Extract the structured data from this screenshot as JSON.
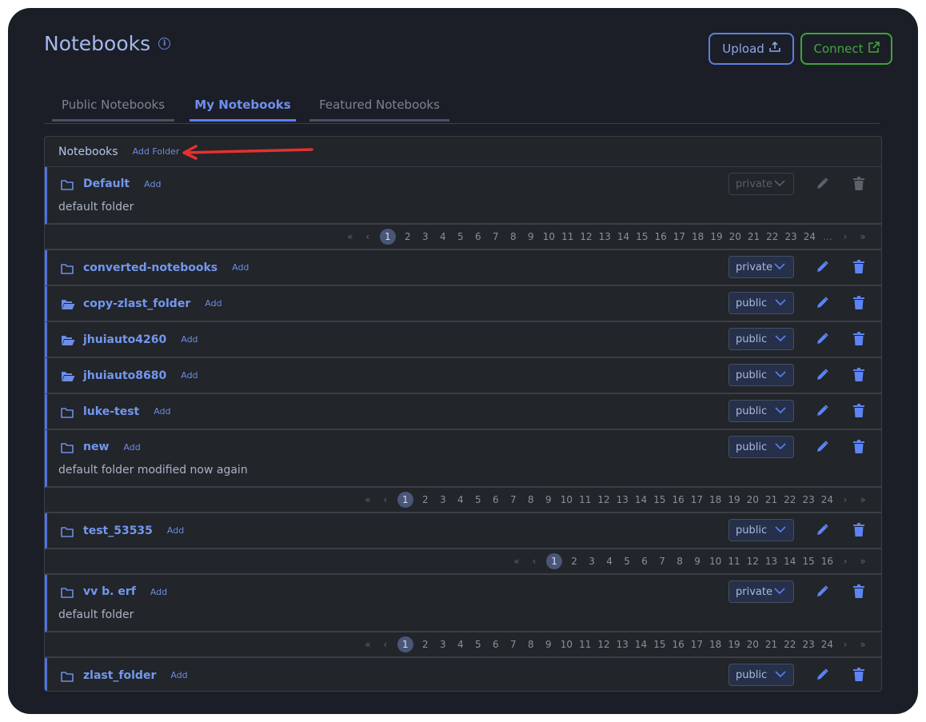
{
  "header": {
    "title": "Notebooks",
    "upload_label": "Upload",
    "connect_label": "Connect"
  },
  "tabs": [
    {
      "label": "Public Notebooks",
      "active": false
    },
    {
      "label": "My Notebooks",
      "active": true
    },
    {
      "label": "Featured Notebooks",
      "active": false
    }
  ],
  "panel": {
    "title": "Notebooks",
    "add_folder_label": "Add Folder"
  },
  "folders": [
    {
      "name": "Default",
      "icon": "folder-outline",
      "add_label": "Add",
      "visibility": "private",
      "disabled": true,
      "description": "default folder",
      "pager": {
        "pages": [
          "1",
          "2",
          "3",
          "4",
          "5",
          "6",
          "7",
          "8",
          "9",
          "10",
          "11",
          "12",
          "13",
          "14",
          "15",
          "16",
          "17",
          "18",
          "19",
          "20",
          "21",
          "22",
          "23",
          "24"
        ],
        "ellipsis": true,
        "current": "1"
      }
    },
    {
      "name": "converted-notebooks",
      "icon": "folder-outline",
      "add_label": "Add",
      "visibility": "private",
      "disabled": false
    },
    {
      "name": "copy-zlast_folder",
      "icon": "folder-open",
      "add_label": "Add",
      "visibility": "public",
      "disabled": false
    },
    {
      "name": "jhuiauto4260",
      "icon": "folder-open",
      "add_label": "Add",
      "visibility": "public",
      "disabled": false
    },
    {
      "name": "jhuiauto8680",
      "icon": "folder-open",
      "add_label": "Add",
      "visibility": "public",
      "disabled": false
    },
    {
      "name": "luke-test",
      "icon": "folder-outline",
      "add_label": "Add",
      "visibility": "public",
      "disabled": false
    },
    {
      "name": "new",
      "icon": "folder-outline",
      "add_label": "Add",
      "visibility": "public",
      "disabled": false,
      "description": "default folder modified now again",
      "pager": {
        "pages": [
          "1",
          "2",
          "3",
          "4",
          "5",
          "6",
          "7",
          "8",
          "9",
          "10",
          "11",
          "12",
          "13",
          "14",
          "15",
          "16",
          "17",
          "18",
          "19",
          "20",
          "21",
          "22",
          "23",
          "24"
        ],
        "ellipsis": false,
        "current": "1"
      }
    },
    {
      "name": "test_53535",
      "icon": "folder-outline",
      "add_label": "Add",
      "visibility": "public",
      "disabled": false,
      "pager": {
        "pages": [
          "1",
          "2",
          "3",
          "4",
          "5",
          "6",
          "7",
          "8",
          "9",
          "10",
          "11",
          "12",
          "13",
          "14",
          "15",
          "16"
        ],
        "ellipsis": false,
        "current": "1"
      }
    },
    {
      "name": "vv b. erf",
      "icon": "folder-outline",
      "add_label": "Add",
      "visibility": "private",
      "disabled": false,
      "description": "default folder",
      "pager": {
        "pages": [
          "1",
          "2",
          "3",
          "4",
          "5",
          "6",
          "7",
          "8",
          "9",
          "10",
          "11",
          "12",
          "13",
          "14",
          "15",
          "16",
          "17",
          "18",
          "19",
          "20",
          "21",
          "22",
          "23",
          "24"
        ],
        "ellipsis": false,
        "current": "1"
      }
    },
    {
      "name": "zlast_folder",
      "icon": "folder-outline",
      "add_label": "Add",
      "visibility": "public",
      "disabled": false
    }
  ],
  "pager_symbols": {
    "first": "«",
    "prev": "‹",
    "next": "›",
    "last": "»",
    "ellipsis": "..."
  },
  "colors": {
    "accent": "#5b7ff0",
    "connect": "#3ea33a",
    "annotation_arrow": "#e53030"
  }
}
